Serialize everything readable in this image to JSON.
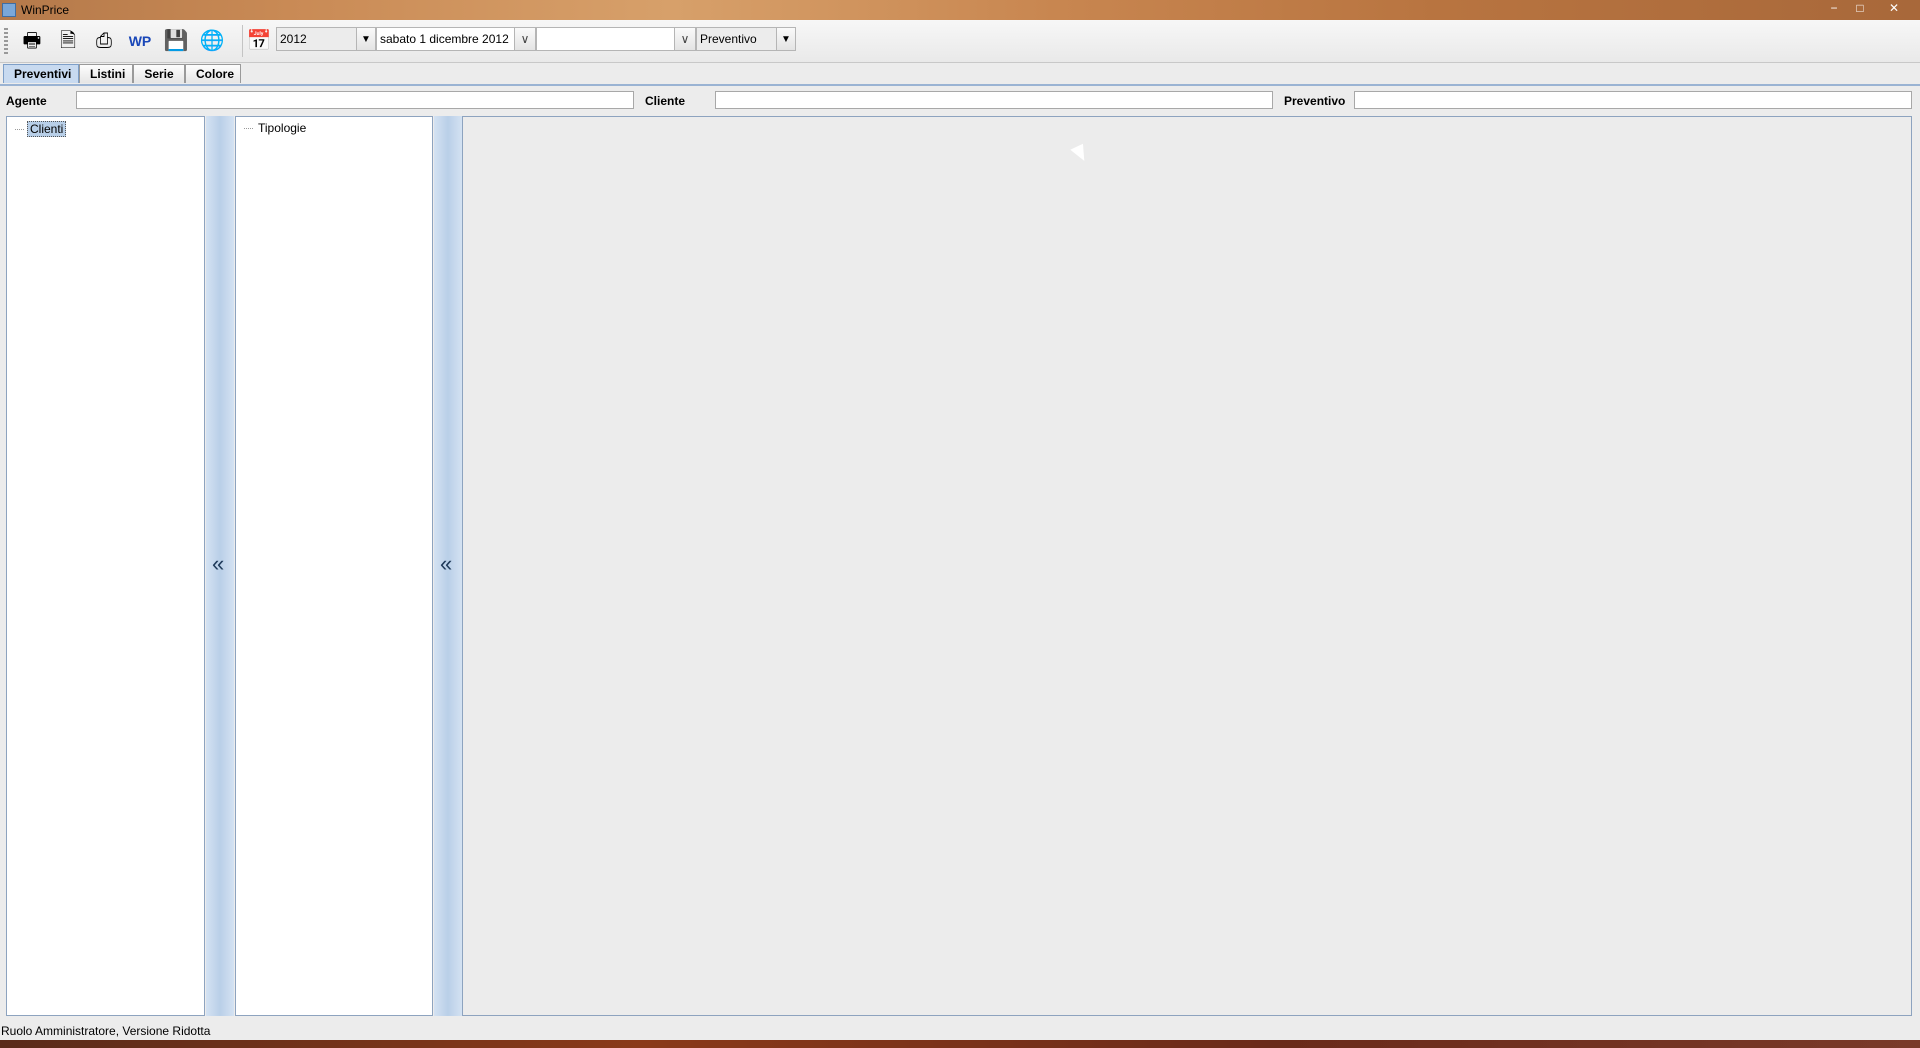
{
  "window": {
    "title": "WinPrice"
  },
  "toolbar": {
    "icons": [
      "print-export-icon",
      "print-preview-icon",
      "printer-icon",
      "wp-word-icon",
      "save-icon",
      "globe-icon",
      "calendar-icon"
    ],
    "year_combo": {
      "value": "2012"
    },
    "date_field": {
      "value": "sabato 1 dicembre 2012"
    },
    "second_date_field": {
      "value": ""
    },
    "type_combo": {
      "value": "Preventivo"
    }
  },
  "tabs": [
    {
      "label": "Preventivi",
      "active": true
    },
    {
      "label": "Listini",
      "active": false
    },
    {
      "label": "Serie",
      "active": false
    },
    {
      "label": "Colore",
      "active": false
    }
  ],
  "filters": {
    "agente": {
      "label": "Agente",
      "value": ""
    },
    "cliente": {
      "label": "Cliente",
      "value": ""
    },
    "preventivo": {
      "label": "Preventivo",
      "value": ""
    }
  },
  "tree_clients": {
    "root": "Clienti"
  },
  "tree_types": {
    "root": "Tipologie"
  },
  "splitters": {
    "icon": "chevron-left-double-icon",
    "glyph": "«"
  },
  "status_bar": {
    "text": "Ruolo Amministratore, Versione Ridotta"
  }
}
